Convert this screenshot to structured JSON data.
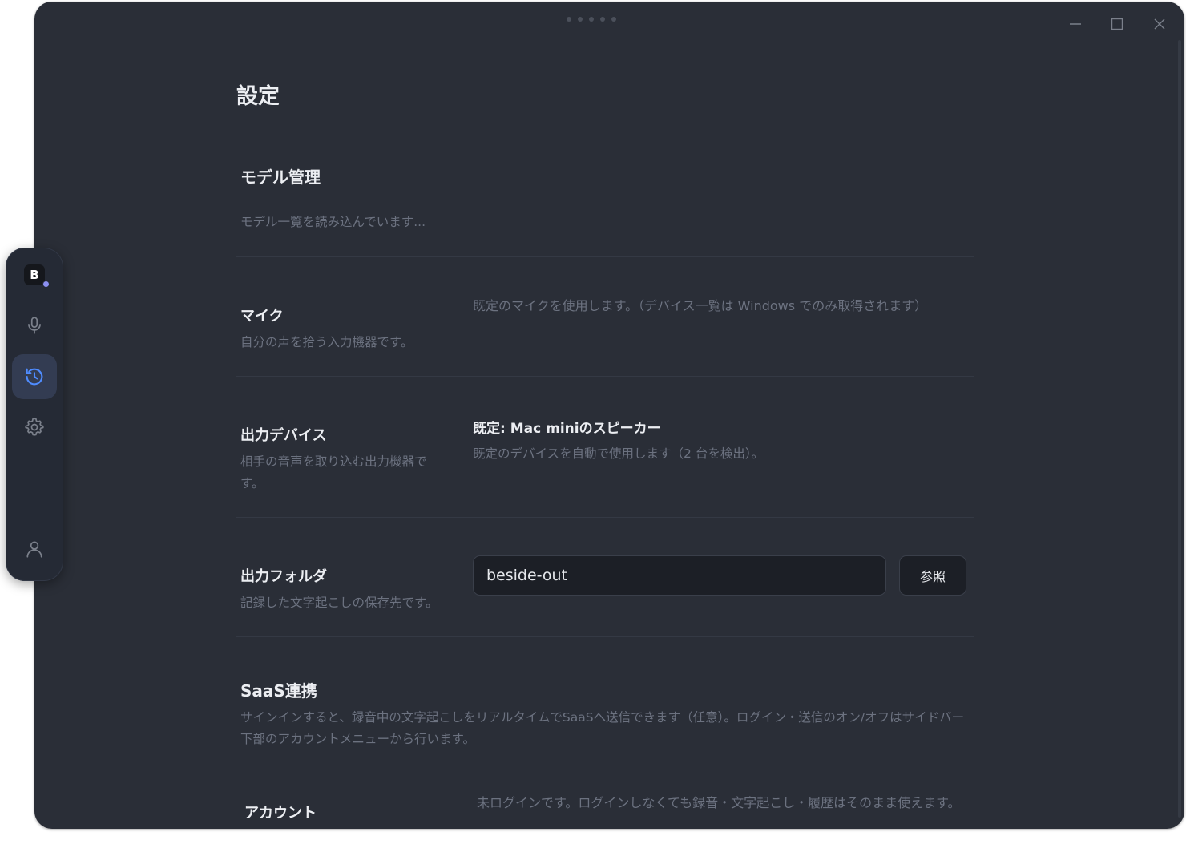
{
  "window": {
    "controls": {
      "minimize": "minimize-icon",
      "maximize": "maximize-icon",
      "close": "close-icon"
    }
  },
  "sidebar": {
    "brand_letter": "B",
    "items": [
      {
        "name": "mic",
        "icon": "microphone-icon",
        "active": false
      },
      {
        "name": "history",
        "icon": "history-icon",
        "active": true
      },
      {
        "name": "settings",
        "icon": "gear-icon",
        "active": false
      }
    ],
    "account_icon": "user-icon",
    "accent": "#4f8cff"
  },
  "page": {
    "title": "設定"
  },
  "model_section": {
    "title": "モデル管理",
    "status": "モデル一覧を読み込んでいます..."
  },
  "mic_row": {
    "label": "マイク",
    "description": "自分の声を拾う入力機器です。",
    "value": "既定のマイクを使用します。（デバイス一覧は Windows でのみ取得されます）"
  },
  "output_device_row": {
    "label": "出力デバイス",
    "description": "相手の音声を取り込む出力機器です。",
    "selected": "既定: Mac miniのスピーカー",
    "hint": "既定のデバイスを自動で使用します（2 台を検出）。"
  },
  "output_folder_row": {
    "label": "出力フォルダ",
    "description": "記録した文字起こしの保存先です。",
    "input_value": "beside-out",
    "browse_label": "参照"
  },
  "saas_section": {
    "title": "SaaS連携",
    "description": "サインインすると、録音中の文字起こしをリアルタイムでSaaSへ送信できます（任意）。ログイン・送信のオン/オフはサイドバー下部のアカウントメニューから行います。"
  },
  "account_row": {
    "label": "アカウント",
    "value": "未ログインです。ログインしなくても録音・文字起こし・履歴はそのまま使えます。"
  },
  "colors": {
    "window_bg": "#2a2e37",
    "text_primary": "#eceef2",
    "text_muted": "#6c7280",
    "input_bg": "#1c1f26"
  }
}
